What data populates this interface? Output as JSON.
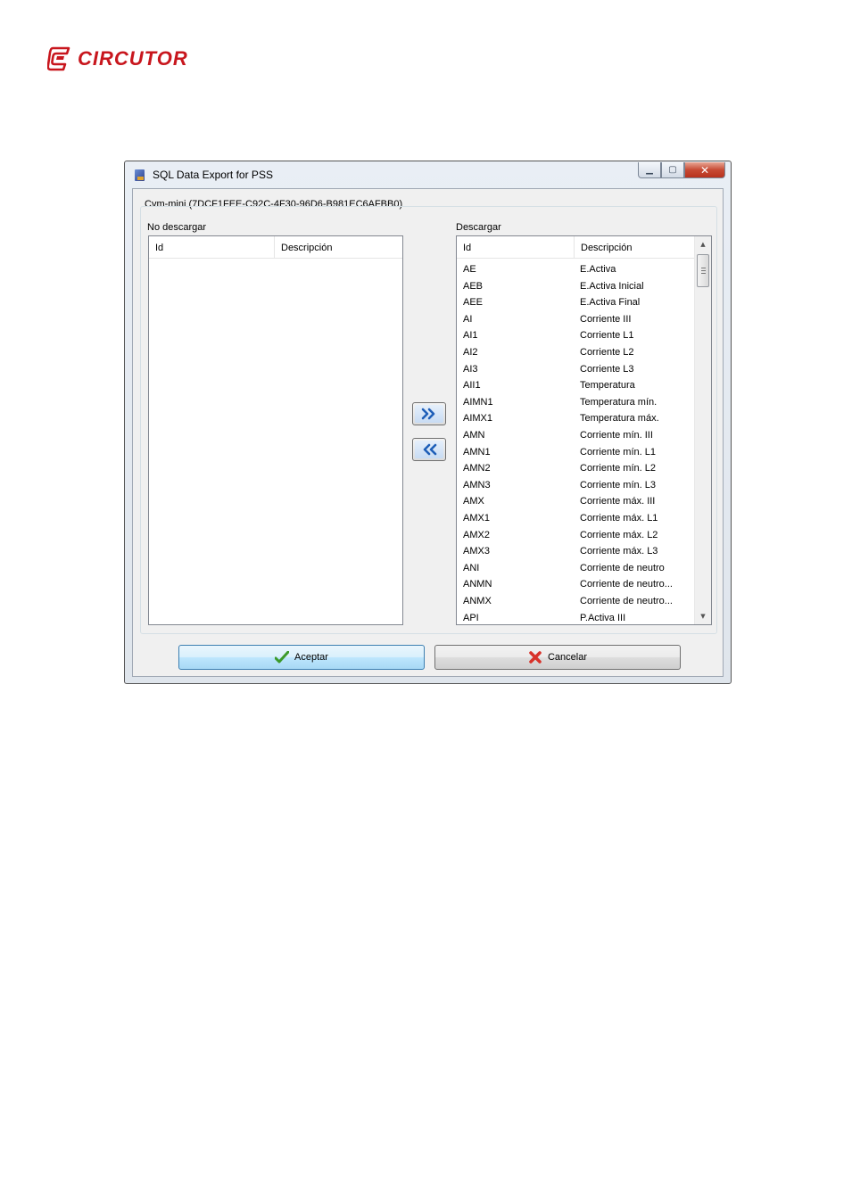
{
  "logo": {
    "text": "CIRCUTOR",
    "brand_color": "#c8161d"
  },
  "window": {
    "title": "SQL Data Export for PSS",
    "controls": {
      "minimize_icon": "minimize-icon",
      "maximize_icon": "maximize-icon",
      "close_icon": "close-icon"
    },
    "group_title": "Cvm-mini (7DCF1FEE-C92C-4F30-96D6-B981EC6AFBB0)",
    "left_list": {
      "label": "No descargar",
      "columns": [
        "Id",
        "Descripción"
      ],
      "rows": []
    },
    "right_list": {
      "label": "Descargar",
      "columns": [
        "Id",
        "Descripción"
      ],
      "rows": [
        {
          "id": "AE",
          "desc": "E.Activa"
        },
        {
          "id": "AEB",
          "desc": "E.Activa Inicial"
        },
        {
          "id": "AEE",
          "desc": "E.Activa Final"
        },
        {
          "id": "AI",
          "desc": "Corriente III"
        },
        {
          "id": "AI1",
          "desc": "Corriente L1"
        },
        {
          "id": "AI2",
          "desc": "Corriente L2"
        },
        {
          "id": "AI3",
          "desc": "Corriente L3"
        },
        {
          "id": "AII1",
          "desc": "Temperatura"
        },
        {
          "id": "AIMN1",
          "desc": "Temperatura mín."
        },
        {
          "id": "AIMX1",
          "desc": "Temperatura máx."
        },
        {
          "id": "AMN",
          "desc": "Corriente mín. III"
        },
        {
          "id": "AMN1",
          "desc": "Corriente mín. L1"
        },
        {
          "id": "AMN2",
          "desc": "Corriente mín. L2"
        },
        {
          "id": "AMN3",
          "desc": "Corriente mín. L3"
        },
        {
          "id": "AMX",
          "desc": "Corriente máx. III"
        },
        {
          "id": "AMX1",
          "desc": "Corriente máx. L1"
        },
        {
          "id": "AMX2",
          "desc": "Corriente máx. L2"
        },
        {
          "id": "AMX3",
          "desc": "Corriente máx. L3"
        },
        {
          "id": "ANI",
          "desc": "Corriente de neutro"
        },
        {
          "id": "ANMN",
          "desc": "Corriente de neutro..."
        },
        {
          "id": "ANMX",
          "desc": "Corriente de neutro..."
        },
        {
          "id": "API",
          "desc": "P.Activa III"
        }
      ]
    },
    "move_right_icon": "double-chevron-right-icon",
    "move_left_icon": "double-chevron-left-icon",
    "accept_label": "Aceptar",
    "cancel_label": "Cancelar",
    "accept_icon": "checkmark-icon",
    "cancel_icon": "red-x-icon"
  }
}
